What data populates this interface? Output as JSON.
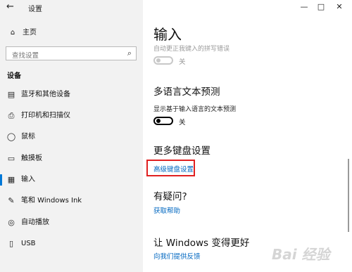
{
  "window": {
    "title": "设置",
    "back_icon": "←",
    "minimize_icon": "—",
    "maximize_icon": "□",
    "close_icon": "✕"
  },
  "sidebar": {
    "home": {
      "icon": "⌂",
      "label": "主页"
    },
    "search_placeholder": "查找设置",
    "search_icon": "⌕",
    "section_title": "设备",
    "items": [
      {
        "icon": "▤",
        "label": "蓝牙和其他设备"
      },
      {
        "icon": "⎙",
        "label": "打印机和扫描仪"
      },
      {
        "icon": "◯",
        "label": "鼠标"
      },
      {
        "icon": "▭",
        "label": "触摸板"
      },
      {
        "icon": "▦",
        "label": "输入"
      },
      {
        "icon": "✎",
        "label": "笔和 Windows Ink"
      },
      {
        "icon": "◎",
        "label": "自动播放"
      },
      {
        "icon": "▯",
        "label": "USB"
      }
    ]
  },
  "main": {
    "title": "输入",
    "autocorrect_desc": "自动更正我键入的拼写错误",
    "autocorrect_state": "关",
    "multilang_title": "多语言文本预测",
    "multilang_desc": "显示基于输入语言的文本预测",
    "multilang_state": "关",
    "more_keyboard_title": "更多键盘设置",
    "advanced_keyboard_link": "高级键盘设置",
    "questions_title": "有疑问?",
    "get_help_link": "获取帮助",
    "improve_title": "让 Windows 变得更好",
    "feedback_link": "向我们提供反馈"
  },
  "watermark": "Bai 经验",
  "colors": {
    "accent": "#0078d7",
    "link": "#0067c0",
    "highlight_box": "#e02020"
  }
}
